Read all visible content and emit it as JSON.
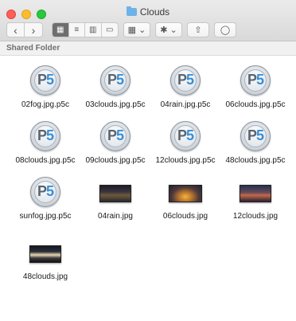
{
  "window": {
    "title": "Clouds",
    "path_label": "Shared Folder"
  },
  "toolbar": {
    "back_label": "‹",
    "forward_label": "›",
    "view_icon": "▦",
    "list_icon": "≡",
    "column_icon": "▥",
    "gallery_icon": "▭",
    "group_icon": "▦ ⌄",
    "action_icon": "✱ ⌄",
    "share_icon": "⇧",
    "tag_icon": "◯"
  },
  "files": [
    {
      "name": "02fog.jpg.p5c",
      "kind": "p5"
    },
    {
      "name": "03clouds.jpg.p5c",
      "kind": "p5"
    },
    {
      "name": "04rain.jpg.p5c",
      "kind": "p5"
    },
    {
      "name": "06clouds.jpg.p5c",
      "kind": "p5"
    },
    {
      "name": "08clouds.jpg.p5c",
      "kind": "p5"
    },
    {
      "name": "09clouds.jpg.p5c",
      "kind": "p5"
    },
    {
      "name": "12clouds.jpg.p5c",
      "kind": "p5"
    },
    {
      "name": "48clouds.jpg.p5c",
      "kind": "p5"
    },
    {
      "name": "sunfog.jpg.p5c",
      "kind": "p5"
    },
    {
      "name": "04rain.jpg",
      "kind": "image"
    },
    {
      "name": "06clouds.jpg",
      "kind": "image"
    },
    {
      "name": "12clouds.jpg",
      "kind": "image"
    },
    {
      "name": "48clouds.jpg",
      "kind": "image"
    }
  ],
  "icon_text": {
    "p": "P",
    "five": "5"
  }
}
